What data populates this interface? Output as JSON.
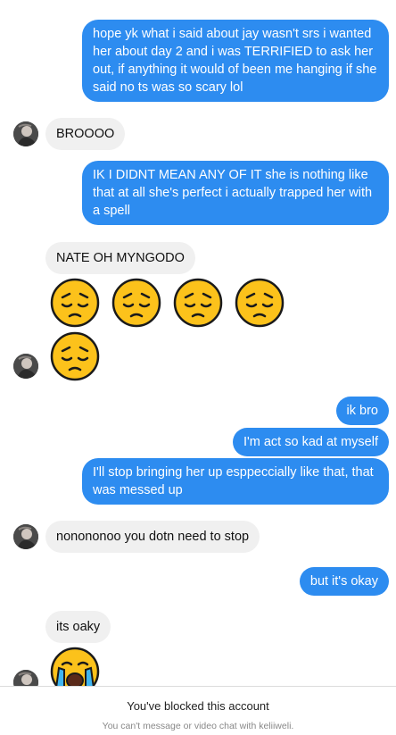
{
  "messages": [
    {
      "side": "out",
      "text": "hope yk what i said about jay wasn't srs i wanted her about day 2 and i was TERRIFIED to ask her out, if anything it would of been me hanging if she said no ts was so scary lol"
    },
    {
      "side": "in",
      "text": "BROOOO"
    },
    {
      "side": "out",
      "text": "IK I DIDNT MEAN ANY OF IT she is nothing like that at all she's perfect i actually trapped her with a spell"
    },
    {
      "side": "in",
      "text": "NATE OH MYNGODO"
    },
    {
      "side": "in",
      "emoji": "pensive-face-emoji",
      "count": 5
    },
    {
      "side": "out",
      "text": "ik bro"
    },
    {
      "side": "out",
      "text": "I'm act so kad at myself"
    },
    {
      "side": "out",
      "text": "I'll stop bringing her up esppeccially like that, that was messed up"
    },
    {
      "side": "in",
      "text": "nonononoo you dotn need to stop"
    },
    {
      "side": "out",
      "text": "but it's okay"
    },
    {
      "side": "in",
      "text": "its oaky"
    },
    {
      "side": "in",
      "emoji": "loudly-crying-face-emoji",
      "count": 1
    }
  ],
  "footer": {
    "blocked_title": "You've blocked this account",
    "blocked_sub": "You can't message or video chat with keliiweli."
  },
  "colors": {
    "outgoing_bubble": "#2d8cf0",
    "incoming_bubble": "#f0f0f0",
    "emoji_yellow": "#fcc21b"
  }
}
